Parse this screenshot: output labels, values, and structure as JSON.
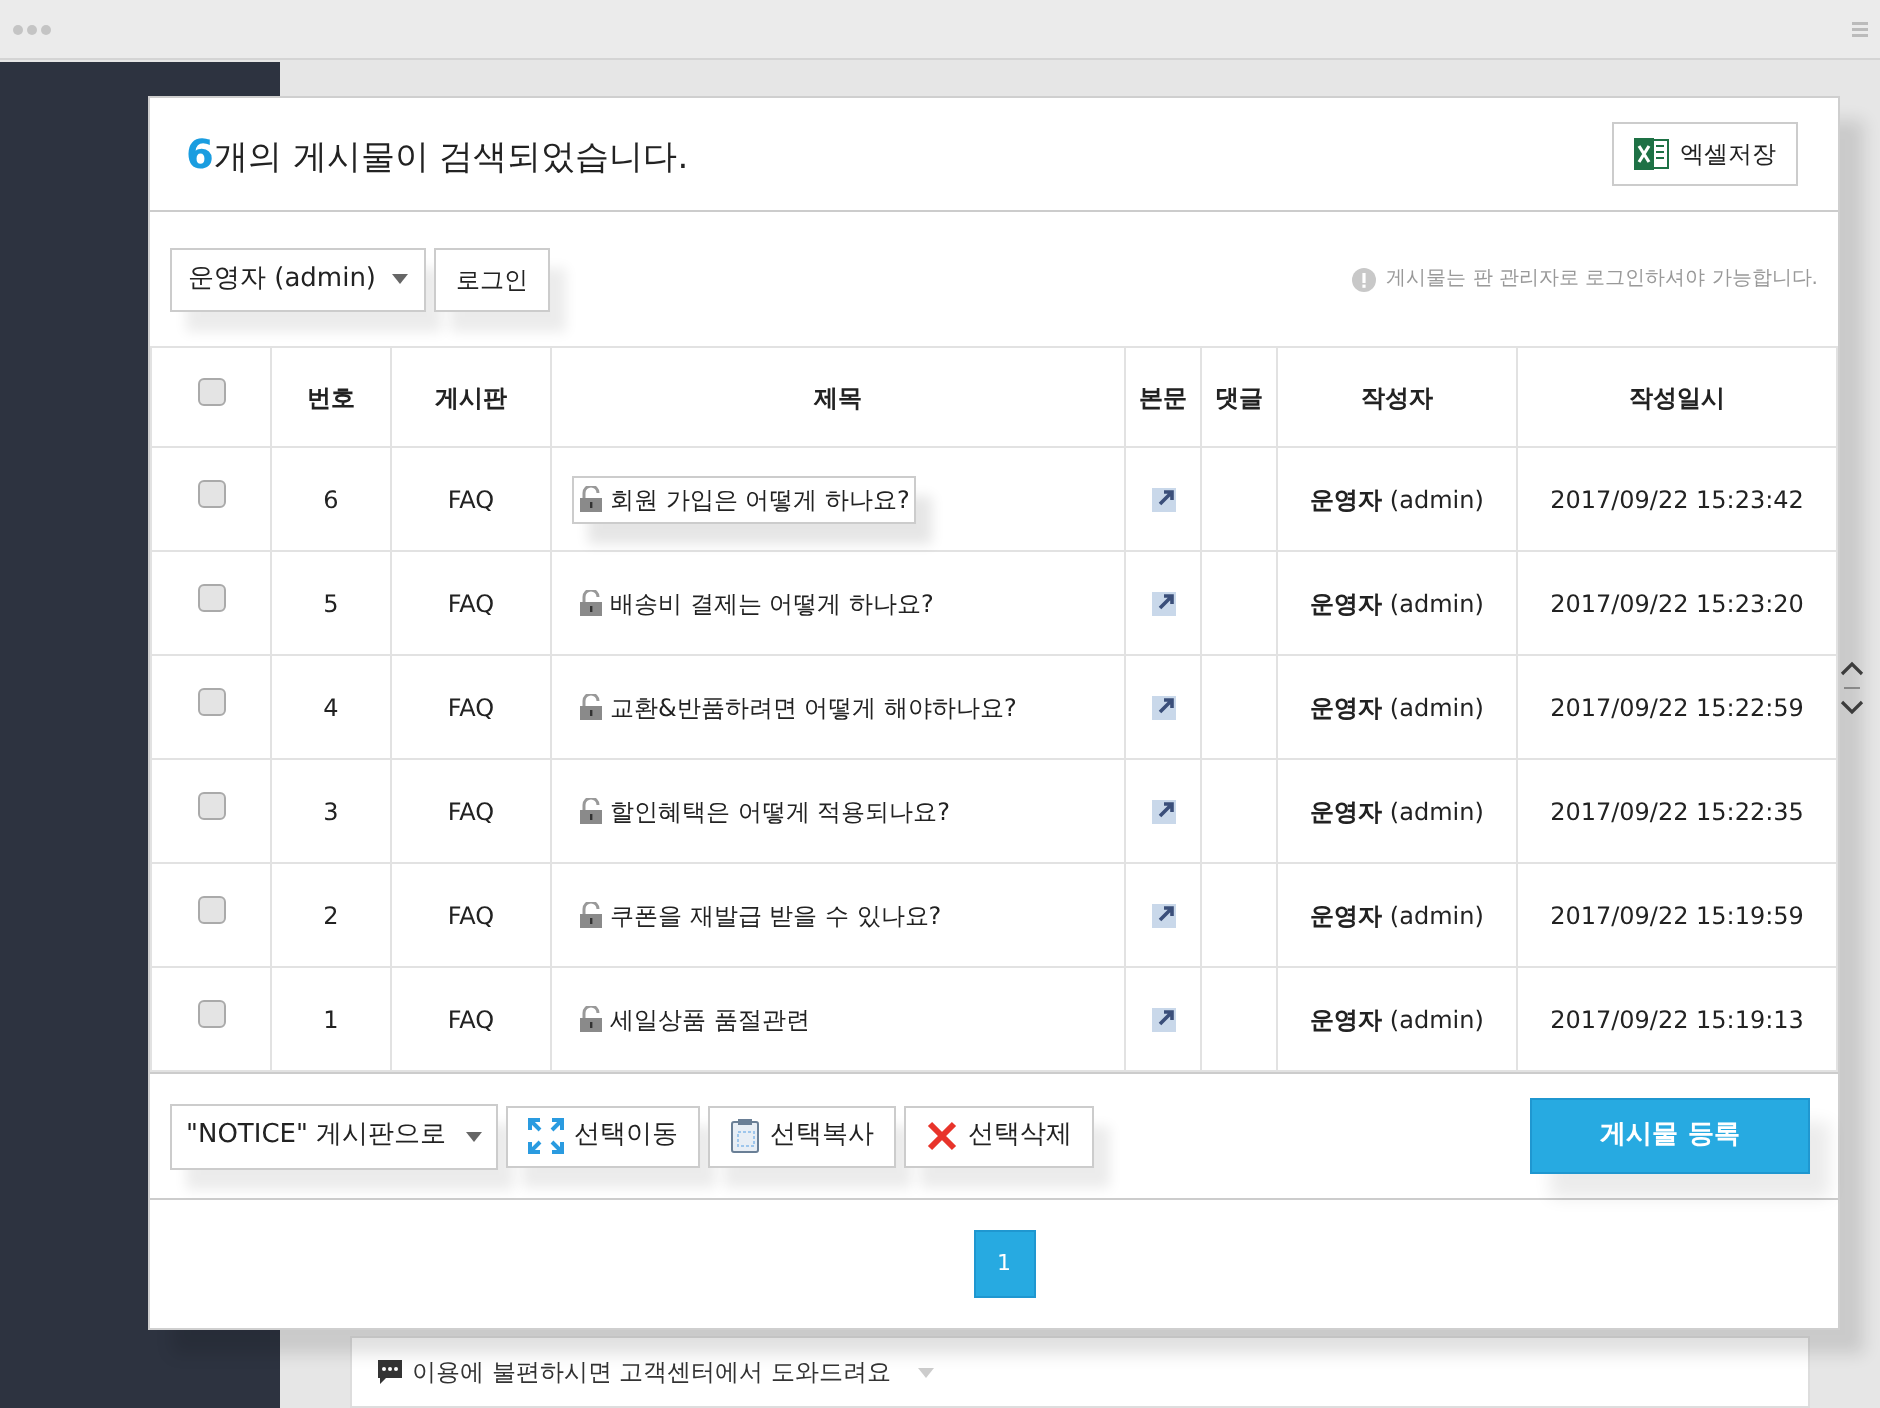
{
  "header": {
    "count": "6",
    "title": "개의 게시물이 검색되었습니다.",
    "excel_button": "엑셀저장"
  },
  "toolbar": {
    "user_select": "운영자 (admin)",
    "login_button": "로그인",
    "notice": "게시물는 판 관리자로 로그인하셔야 가능합니다."
  },
  "table": {
    "select_all": {
      "checked": false
    },
    "columns": [
      "번호",
      "게시판",
      "제목",
      "본문",
      "댓글",
      "작성자",
      "작성일시"
    ],
    "rows": [
      {
        "checked": false,
        "number": "6",
        "board": "FAQ",
        "title": "회원 가입은 어떻게 하나요?",
        "focused": true,
        "author_name": "운영자",
        "author_id": "(admin)",
        "date": "2017/09/22 15:23:42"
      },
      {
        "checked": false,
        "number": "5",
        "board": "FAQ",
        "title": "배송비 결제는 어떻게 하나요?",
        "focused": false,
        "author_name": "운영자",
        "author_id": "(admin)",
        "date": "2017/09/22 15:23:20"
      },
      {
        "checked": false,
        "number": "4",
        "board": "FAQ",
        "title": "교환&반품하려면 어떻게 해야하나요?",
        "focused": false,
        "author_name": "운영자",
        "author_id": "(admin)",
        "date": "2017/09/22 15:22:59"
      },
      {
        "checked": false,
        "number": "3",
        "board": "FAQ",
        "title": "할인혜택은 어떻게 적용되나요?",
        "focused": false,
        "author_name": "운영자",
        "author_id": "(admin)",
        "date": "2017/09/22 15:22:35"
      },
      {
        "checked": false,
        "number": "2",
        "board": "FAQ",
        "title": "쿠폰을 재발급 받을 수 있나요?",
        "focused": false,
        "author_name": "운영자",
        "author_id": "(admin)",
        "date": "2017/09/22 15:19:59"
      },
      {
        "checked": false,
        "number": "1",
        "board": "FAQ",
        "title": "세일상품 품절관련",
        "focused": false,
        "author_name": "운영자",
        "author_id": "(admin)",
        "date": "2017/09/22 15:19:13"
      }
    ]
  },
  "actions": {
    "board_select": "\"NOTICE\" 게시판으로",
    "buttons": [
      {
        "kind": "move",
        "label": "선택이동"
      },
      {
        "kind": "copy",
        "label": "선택복사"
      },
      {
        "kind": "delete",
        "label": "선택삭제"
      }
    ],
    "register_button": "게시물 등록"
  },
  "pagination": [
    {
      "label": "1",
      "selected": true
    }
  ],
  "footer": {
    "help": "이용에 불편하시면 고객센터에서 도와드려요"
  }
}
